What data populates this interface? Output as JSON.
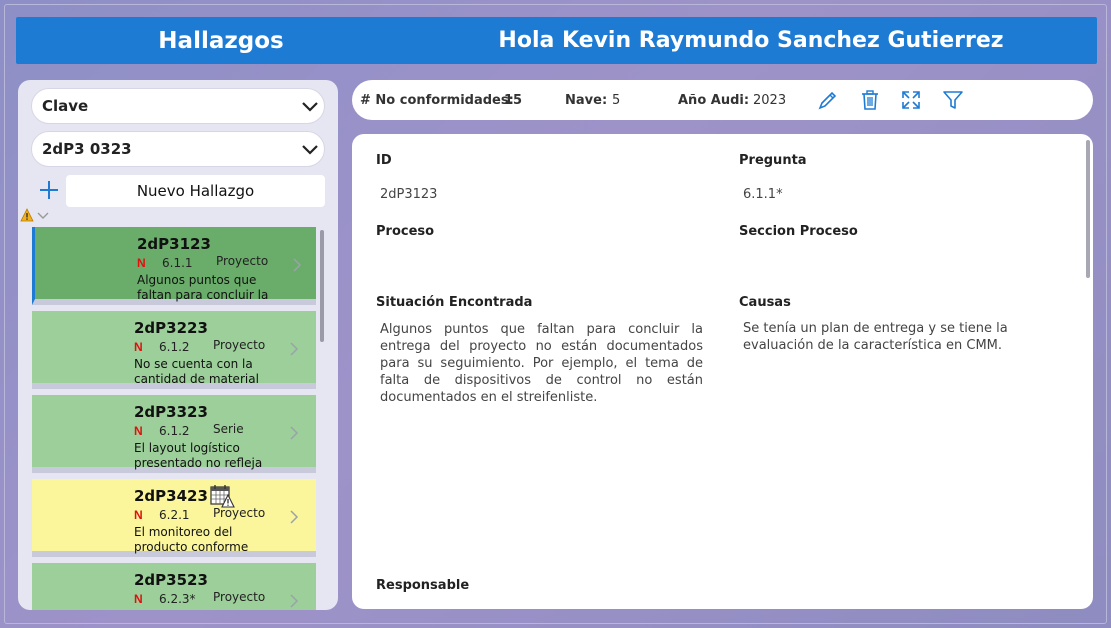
{
  "header": {
    "title": "Hallazgos",
    "greeting": "Hola Kevin Raymundo Sanchez Gutierrez",
    "bg_color": "#1e7bd4"
  },
  "filters": {
    "clave_dropdown": {
      "value": "Clave"
    },
    "code_dropdown": {
      "value": "2dP3 0323"
    },
    "new_button_label": "Nuevo Hallazgo"
  },
  "list": {
    "items": [
      {
        "code": "2dP3123",
        "flag": "N",
        "question": "6.1.1",
        "type": "Proyecto",
        "desc": "Algunos puntos que faltan para concluir la",
        "color": "#6aad6a",
        "selected": true
      },
      {
        "code": "2dP3223",
        "flag": "N",
        "question": "6.1.2",
        "type": "Proyecto",
        "desc": "No se cuenta con la cantidad de material",
        "color": "#9ccf9a",
        "selected": false
      },
      {
        "code": "2dP3323",
        "flag": "N",
        "question": "6.1.2",
        "type": "Serie",
        "desc": "El layout  logístico presentado no refleja",
        "color": "#9ccf9a",
        "selected": false
      },
      {
        "code": "2dP3423",
        "flag": "N",
        "question": "6.2.1",
        "type": "Proyecto",
        "desc": "El monitoreo del producto conforme",
        "color": "#fbf69c",
        "selected": false,
        "calendar_icon": "calendar-warning-icon"
      },
      {
        "code": "2dP3523",
        "flag": "N",
        "question": "6.2.3*",
        "type": "Proyecto",
        "desc": "",
        "color": "#9ccf9a",
        "selected": false
      }
    ]
  },
  "summary": {
    "nc_label": "# No conformidades:",
    "nc_value": "15",
    "nave_label": "Nave:",
    "nave_value": "5",
    "anio_label": "Año Audi:",
    "anio_value": "2023"
  },
  "detail": {
    "id_label": "ID",
    "id_value": "2dP3123",
    "pregunta_label": "Pregunta",
    "pregunta_value": "6.1.1*",
    "proceso_label": "Proceso",
    "proceso_value": "",
    "seccion_label": "Seccion Proceso",
    "seccion_value": "",
    "situacion_label": "Situación Encontrada",
    "situacion_value": "Algunos puntos que faltan para concluir la entrega del proyecto no están documentados para su seguimiento. Por ejemplo,  el tema de falta de dispositivos de control no están documentados en el streifenliste.",
    "causas_label": "Causas",
    "causas_value": "Se tenía un plan de entrega y se tiene la evaluación de la característica en CMM.",
    "responsable_label": "Responsable"
  }
}
